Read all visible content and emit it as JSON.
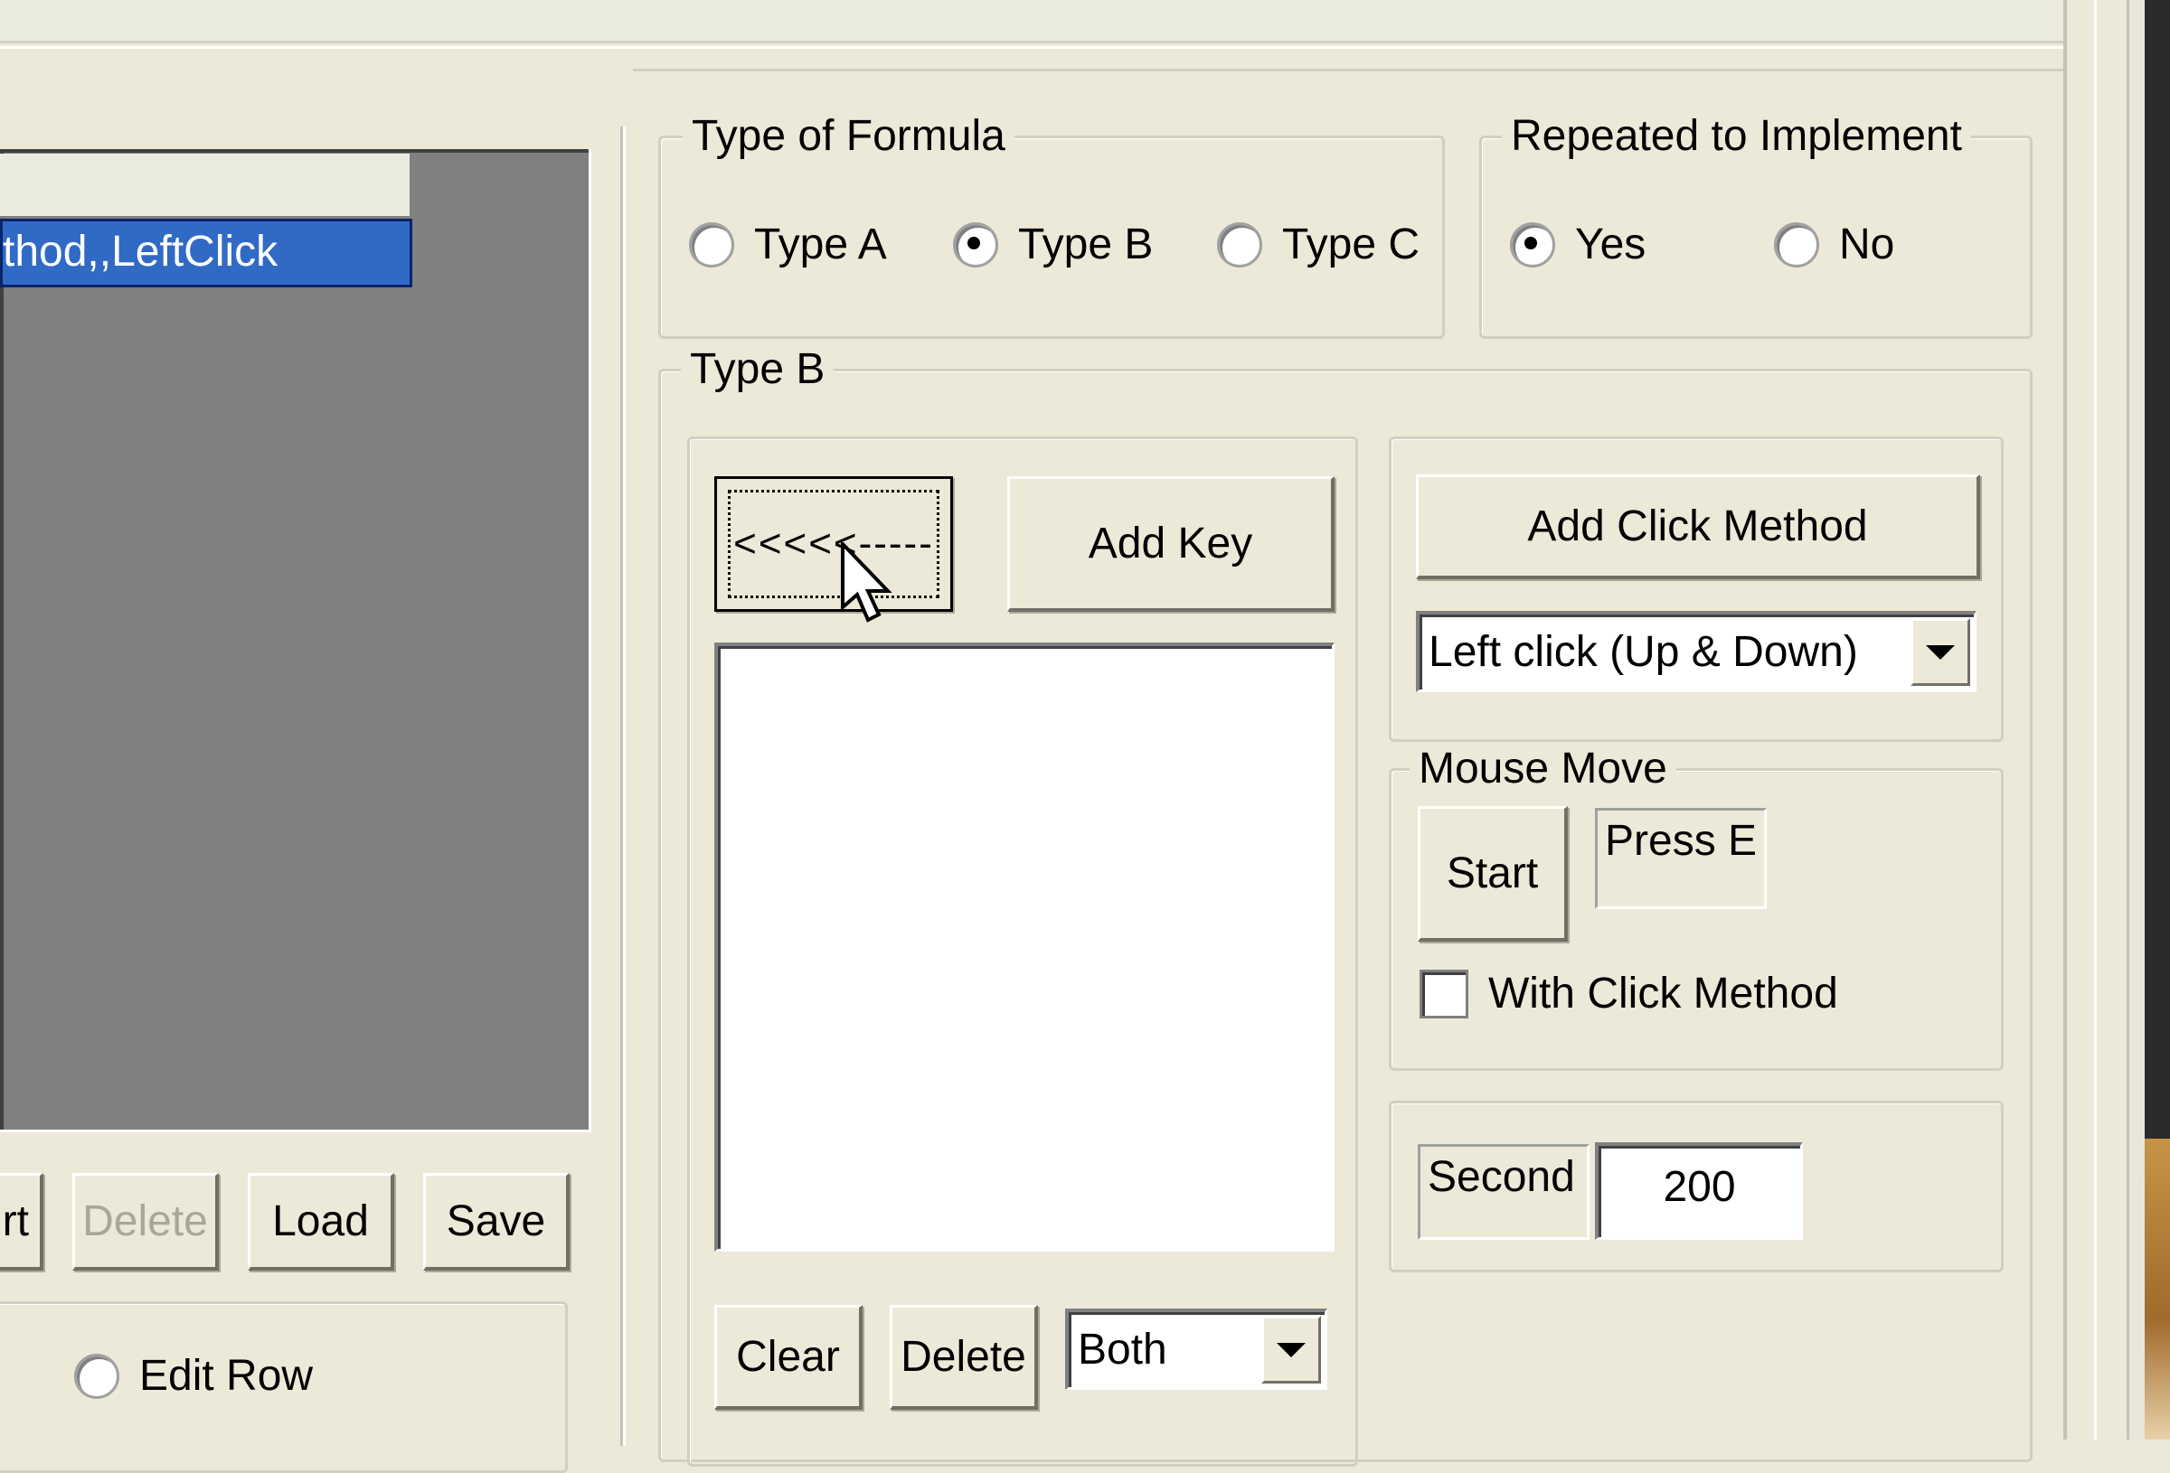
{
  "list": {
    "selected_row": "thod,,LeftClick",
    "header": ""
  },
  "left_buttons": {
    "partial": "rt",
    "delete": "Delete",
    "load": "Load",
    "save": "Save"
  },
  "edit_row": {
    "label": "Edit Row",
    "checked": false
  },
  "type_of_formula": {
    "legend": "Type of Formula",
    "options": [
      {
        "label": "Type A",
        "checked": false
      },
      {
        "label": "Type B",
        "checked": true
      },
      {
        "label": "Type C",
        "checked": false
      }
    ]
  },
  "repeated": {
    "legend": "Repeated to Implement",
    "options": [
      {
        "label": "Yes",
        "checked": true
      },
      {
        "label": "No",
        "checked": false
      }
    ]
  },
  "type_b": {
    "legend": "Type B",
    "backspace_button": "<<<<<-----",
    "add_key_button": "Add Key",
    "key_list": [],
    "clear_button": "Clear",
    "delete_button": "Delete",
    "mode_select": "Both"
  },
  "click_method": {
    "add_button": "Add Click Method",
    "select_value": "Left click (Up & Down)"
  },
  "mouse_move": {
    "legend": "Mouse Move",
    "start_button": "Start",
    "press_label": "Press E",
    "with_click_label": "With Click Method",
    "with_click_checked": false
  },
  "delay": {
    "label": "Second",
    "value": "200"
  }
}
